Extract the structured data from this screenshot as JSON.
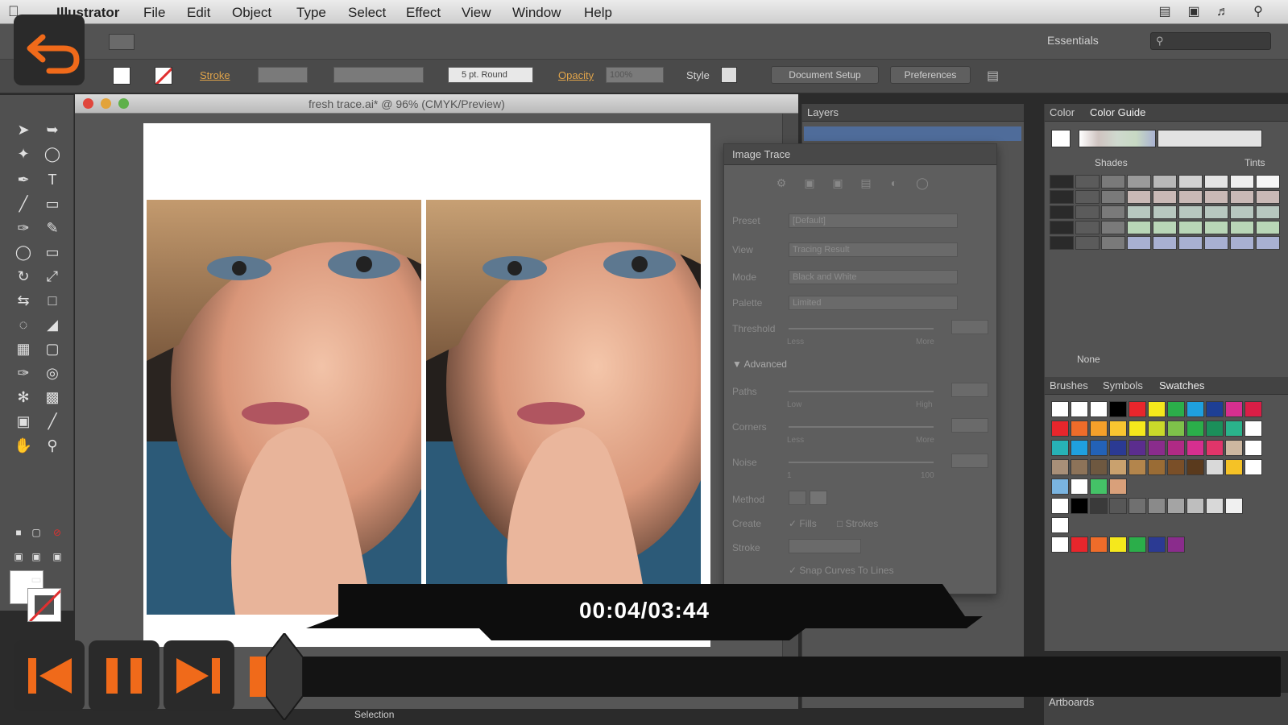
{
  "menubar": {
    "app": "Illustrator",
    "items": [
      "File",
      "Edit",
      "Object",
      "Type",
      "Select",
      "Effect",
      "View",
      "Window",
      "Help"
    ]
  },
  "appbar": {
    "workspace": "Essentials"
  },
  "control": {
    "stroke_label": "Stroke",
    "brush_value": "5 pt. Round",
    "opacity_label": "Opacity",
    "opacity_value": "100%",
    "style_label": "Style",
    "doc_setup_label": "Document Setup",
    "preferences_label": "Preferences"
  },
  "document": {
    "title": "fresh trace.ai* @ 96% (CMYK/Preview)"
  },
  "layers_panel": {
    "tab": "Layers"
  },
  "image_trace": {
    "title": "Image Trace",
    "preset_label": "Preset",
    "preset_value": "[Default]",
    "view_label": "View",
    "view_value": "Tracing Result",
    "mode_label": "Mode",
    "mode_value": "Black and White",
    "palette_label": "Palette",
    "palette_value": "Limited",
    "threshold_label": "Threshold",
    "less": "Less",
    "more": "More",
    "advanced_label": "Advanced",
    "paths_label": "Paths",
    "low": "Low",
    "high": "High",
    "corners_label": "Corners",
    "noise_label": "Noise",
    "noise_min": "1",
    "noise_max": "100",
    "method_label": "Method",
    "create_label": "Create",
    "fills_label": "Fills",
    "strokes_label": "Strokes",
    "stroke_label": "Stroke",
    "snap_label": "Snap Curves To Lines"
  },
  "color_panel": {
    "tab_color": "Color",
    "tab_guide": "Color Guide",
    "shades": "Shades",
    "tints": "Tints",
    "none_label": "None"
  },
  "swatches_panel": {
    "tab_brushes": "Brushes",
    "tab_symbols": "Symbols",
    "tab_swatches": "Swatches"
  },
  "artboards_panel": {
    "tab": "Artboards"
  },
  "status": {
    "selection": "Selection"
  },
  "player": {
    "time": "00:04/03:44",
    "progress": 0.018,
    "accent": "#f06a1a"
  }
}
